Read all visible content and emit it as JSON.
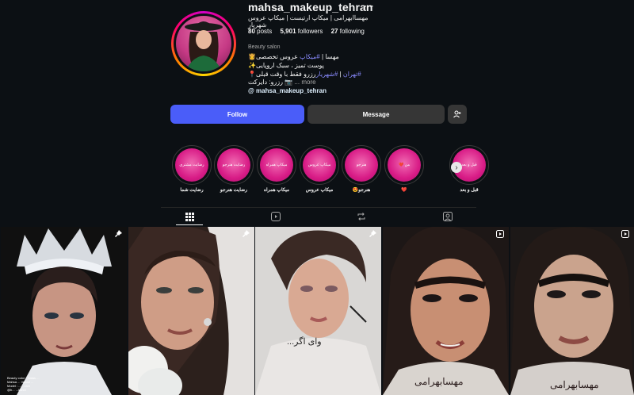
{
  "profile": {
    "username": "mahsa_makeup_tehran",
    "more_icon": "more-horizontal-icon",
    "full_name": "مهساابهرامی | میکاپ ارتیست | میکاپ عروس شهریار",
    "posts_count": "80",
    "posts_label": "posts",
    "followers_count": "5,901",
    "followers_label": "followers",
    "following_count": "27",
    "following_label": "following",
    "category": "Beauty salon",
    "bio": {
      "line1_prefix": "مهسا | ",
      "line1_tag": "#میکاپ",
      "line1_suffix": " عروس تخصصی",
      "line2": "پوست تمیز ، سبک اروپایی",
      "line3_prefix": "رزرو فقط با وقت قبلی  ",
      "line3_tag1": "#تهران",
      "line3_sep": " | ",
      "line3_tag2": "#شهریار",
      "line4": "رزرو: دایرکت",
      "more": "... more"
    },
    "link_text": "mahsa_makeup_tehran"
  },
  "actions": {
    "follow_label": "Follow",
    "message_label": "Message",
    "suggest_icon": "add-person-icon"
  },
  "highlights": [
    {
      "label": "قبل و بعد",
      "cover": "قبل و بعد"
    },
    {
      "label": "❤️",
      "cover": "من ❤️"
    },
    {
      "label": "هنرجو😍",
      "cover": "هنرجو"
    },
    {
      "label": "میکاپ عروس",
      "cover": "میکاپ عروس"
    },
    {
      "label": "میکاپ همراه",
      "cover": "میکاپ همراه"
    },
    {
      "label": "رضایت هنرجو",
      "cover": "رضایت هنرجو"
    },
    {
      "label": "رضایت شما",
      "cover": "رضایت مشتری"
    }
  ],
  "tabs": [
    {
      "name": "posts",
      "icon": "grid-icon",
      "active": true
    },
    {
      "name": "reels",
      "icon": "reels-icon",
      "active": false
    },
    {
      "name": "reposts",
      "icon": "repost-icon",
      "active": false
    },
    {
      "name": "tagged",
      "icon": "tagged-icon",
      "active": false
    }
  ],
  "posts": [
    {
      "type": "pinned",
      "icon": "pin-icon",
      "caption_lines": [
        "Beauty color : Nafas ...",
        "Mahsa ... Vahad ...",
        "Model : ... ...ram",
        "@h... ...kandi"
      ]
    },
    {
      "type": "pinned",
      "icon": "pin-icon",
      "caption_lines": []
    },
    {
      "type": "pinned",
      "icon": "pin-icon",
      "caption_lines": [],
      "overlay_text": "وای اگر..."
    },
    {
      "type": "reel",
      "icon": "reel-icon",
      "caption_lines": [],
      "overlay_text": "مهسابهرامی"
    },
    {
      "type": "reel",
      "icon": "reel-icon",
      "caption_lines": [],
      "overlay_text": "مهسابهرامی"
    }
  ],
  "colors": {
    "background": "#0c1014",
    "follow_button": "#4a5df9",
    "secondary_button": "#363636",
    "hashtag": "#8a8bff",
    "highlight_pink": "#d81b86"
  }
}
